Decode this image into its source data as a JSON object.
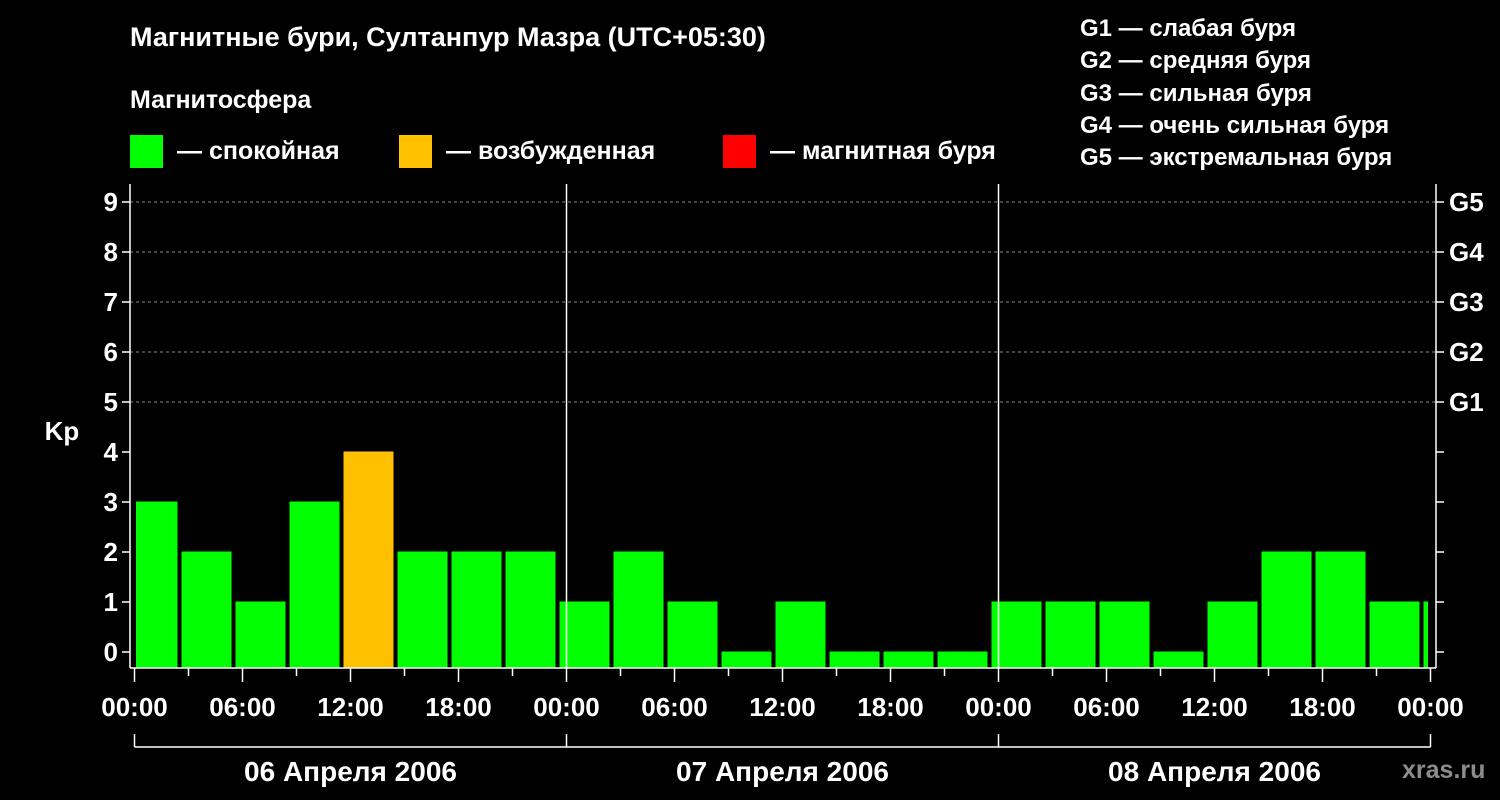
{
  "header": {
    "title": "Магнитные бури, Султанпур Мазра (UTC+05:30)",
    "subtitle": "Магнитосфера"
  },
  "legend": [
    {
      "label": "— спокойная",
      "color": "#00ff00"
    },
    {
      "label": "— возбужденная",
      "color": "#ffc000"
    },
    {
      "label": "— магнитная буря",
      "color": "#ff0000"
    }
  ],
  "storm_legend": [
    "G1 — слабая буря",
    "G2 — средняя буря",
    "G3 — сильная буря",
    "G4 — очень сильная буря",
    "G5 — экстремальная буря"
  ],
  "watermark": "xras.ru",
  "chart_data": {
    "type": "bar",
    "ylabel": "Kp",
    "ylim": [
      0,
      9
    ],
    "y_ticks": [
      "0",
      "1",
      "2",
      "3",
      "4",
      "5",
      "6",
      "7",
      "8",
      "9"
    ],
    "right_ticks": [
      {
        "value": 5,
        "label": "G1"
      },
      {
        "value": 6,
        "label": "G2"
      },
      {
        "value": 7,
        "label": "G3"
      },
      {
        "value": 8,
        "label": "G4"
      },
      {
        "value": 9,
        "label": "G5"
      }
    ],
    "x_tick_labels": [
      "00:00",
      "06:00",
      "12:00",
      "18:00",
      "00:00",
      "06:00",
      "12:00",
      "18:00",
      "00:00",
      "06:00",
      "12:00",
      "18:00",
      "00:00"
    ],
    "days": [
      "06 Апреля 2006",
      "07 Апреля 2006",
      "08 Апреля 2006"
    ],
    "interval_hours": 3,
    "start_offset_hours": -0.5,
    "grid": true,
    "values": [
      3,
      2,
      1,
      3,
      4,
      2,
      2,
      2,
      1,
      2,
      1,
      0,
      1,
      0,
      0,
      0,
      1,
      1,
      1,
      0,
      1,
      2,
      2,
      1,
      1
    ],
    "colors": {
      "quiet": "#00ff00",
      "active": "#ffc000",
      "storm": "#ff0000"
    }
  }
}
